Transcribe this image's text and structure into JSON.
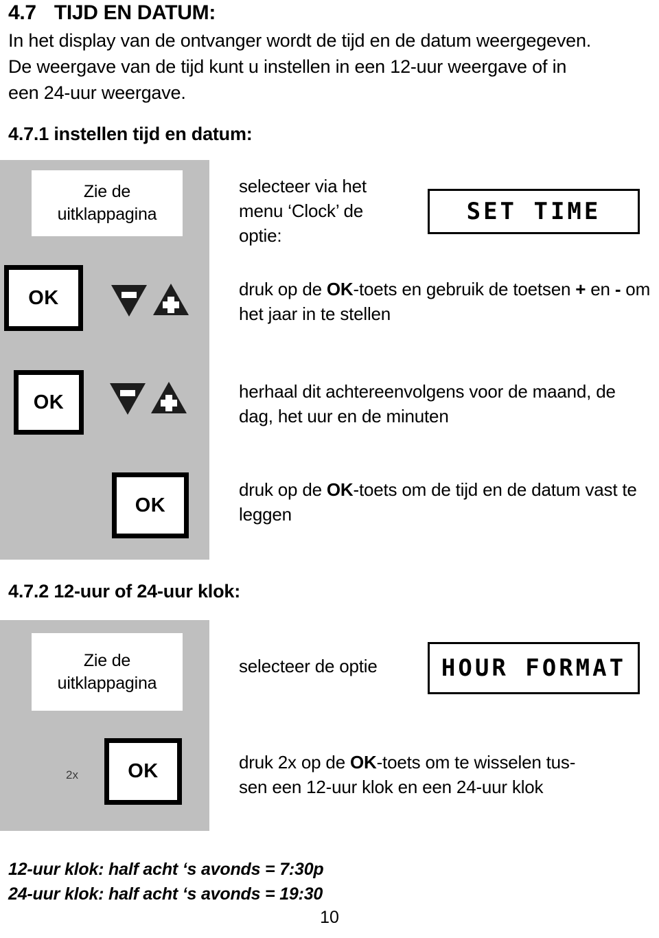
{
  "document": {
    "page_number": "10"
  },
  "section": {
    "number": "4.7",
    "title": "TIJD EN DATUM:",
    "intro_lines": [
      "In het display van de ontvanger wordt de tijd en de datum weergegeven.",
      "De weergave van de tijd kunt u instellen in een 12-uur weergave of in",
      "een 24-uur weergave."
    ]
  },
  "subsection_1": {
    "heading": "4.7.1 instellen tijd en datum:",
    "flapcard_label": "Zie de\nuitklappagina",
    "rows": [
      {
        "instruction_pre": "selecteer via het menu ‘Clock’ de optie:",
        "lcd_text": "SET TIME"
      },
      {
        "ok_label": "OK",
        "minus_icon": "minus-triangle-down-icon",
        "plus_icon": "plus-triangle-up-icon",
        "instruction_parts": [
          "druk op de ",
          "OK",
          "-toets en gebruik de toetsen ",
          "+",
          " en ",
          "-",
          " om het jaar in te stellen"
        ]
      },
      {
        "ok_label": "OK",
        "minus_icon": "minus-triangle-down-icon",
        "plus_icon": "plus-triangle-up-icon",
        "instruction": "herhaal dit achtereenvolgens voor de maand, de dag, het uur en de minuten"
      },
      {
        "ok_label": "OK",
        "instruction_parts": [
          "druk op de ",
          "OK",
          "-toets om de tijd en de datum vast te leggen"
        ]
      }
    ]
  },
  "subsection_2": {
    "heading": "4.7.2 12-uur of 24-uur klok:",
    "flapcard_label": "Zie de\nuitklappagina",
    "rows": [
      {
        "instruction": "selecteer de optie",
        "lcd_text": "HOUR FORMAT"
      },
      {
        "repeat_label": "2x",
        "ok_label": "OK",
        "instruction_parts": [
          "druk 2x op de ",
          "OK",
          "-toets om te wisselen tus-",
          "sen een 12-uur klok en een 24-uur klok"
        ]
      }
    ]
  },
  "footer_notes": [
    "12-uur klok: half acht ‘s avonds = 7:30p",
    "24-uur klok: half acht ‘s avonds = 19:30"
  ],
  "colors": {
    "panel_gray": "#bfbfbf",
    "ink": "#000000",
    "paper": "#ffffff"
  }
}
